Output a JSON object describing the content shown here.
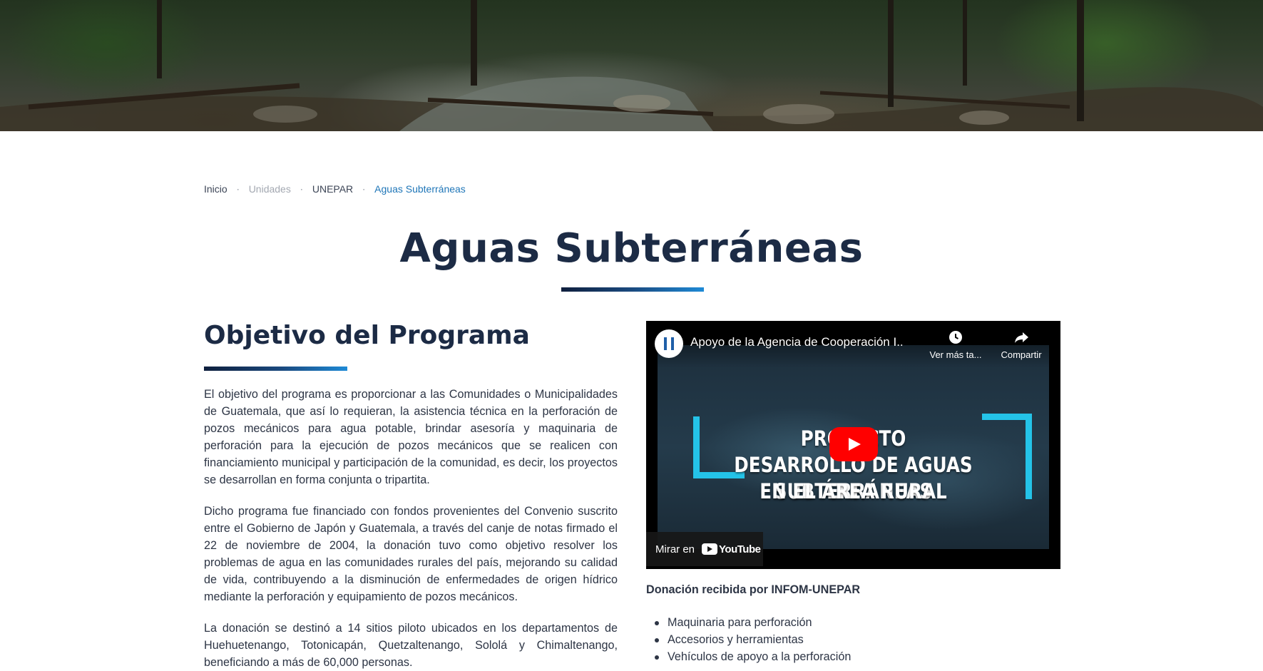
{
  "breadcrumb": {
    "items": [
      "Inicio",
      "Unidades",
      "UNEPAR",
      "Aguas Subterráneas"
    ],
    "separator": "·"
  },
  "page": {
    "title": "Aguas Subterráneas"
  },
  "section": {
    "heading": "Objetivo del Programa",
    "paragraphs": [
      "El objetivo del programa es proporcionar a las Comunidades o Municipalidades de Guatemala, que así lo requieran, la asistencia técnica en la perforación de pozos mecánicos para agua potable, brindar asesoría y maquinaria de perforación para la ejecución de pozos mecánicos que se realicen con financiamiento municipal y participación de la comunidad, es decir, los proyectos se desarrollan en forma conjunta o tripartita.",
      "Dicho programa fue financiado con fondos provenientes del Convenio suscrito entre el Gobierno de Japón y Guatemala, a través del canje de notas firmado el 22 de noviembre de 2004, la donación tuvo como objetivo resolver los problemas de agua en las comunidades rurales del país, mejorando su calidad de vida, contribuyendo a la disminución de enfermedades de origen hídrico mediante la perforación y equipamiento de pozos mecánicos.",
      "La donación se destinó a 14 sitios piloto ubicados en los departamentos de Huehuetenango, Totonicapán, Quetzaltenango, Sololá y Chimaltenango, beneficiando a más de 60,000 personas."
    ]
  },
  "video": {
    "title": "Apoyo de la Agencia de Cooperación I...",
    "watch_later": "Ver más ta...",
    "share": "Compartir",
    "watch_on": "Mirar en",
    "youtube_logo": "YouTube",
    "thumbnail_lines": [
      "PROYECTO",
      "DESARROLLO DE AGUAS SUBTERRÁNEAS",
      "EN EL ÁREA RURAL"
    ]
  },
  "donation": {
    "heading": "Donación recibida por INFOM-UNEPAR",
    "items": [
      "Maquinaria para perforación",
      "Accesorios y herramientas",
      "Vehículos de apoyo a la perforación"
    ]
  },
  "colors": {
    "title": "#1c2b45",
    "accent_blue": "#1f76b8",
    "gradient_start": "#0f1f3d",
    "gradient_end": "#1e8ad6",
    "frame_cyan": "#24c3e8",
    "play_red": "#ff0000"
  }
}
